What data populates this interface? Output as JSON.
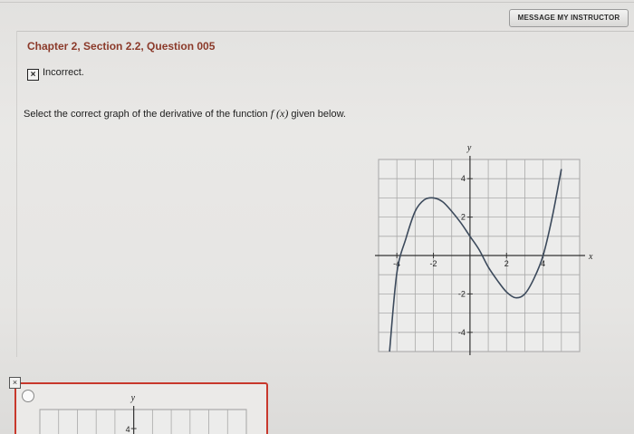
{
  "header": {
    "message_button": "MESSAGE MY INSTRUCTOR"
  },
  "question": {
    "title": "Chapter 2, Section 2.2, Question 005",
    "status": "Incorrect.",
    "status_icon": "x-mark-icon",
    "prompt_text": "Select the correct graph of the derivative of the function ",
    "prompt_math": "f (x)",
    "prompt_suffix": " given below."
  },
  "main_graph": {
    "x_axis_label": "x",
    "y_axis_label": "y",
    "x_tick_labels": [
      "-4",
      "-2",
      "2",
      "4"
    ],
    "y_tick_labels": [
      "4",
      "2",
      "-2",
      "-4"
    ],
    "curve_color": "#3c4a5c"
  },
  "answer_option": {
    "y_axis_label": "y",
    "y_tick_label": "4",
    "marker_label": "×",
    "border_color": "#c8382c"
  },
  "chart_data": {
    "type": "line",
    "title": "",
    "xlabel": "x",
    "ylabel": "y",
    "xlim": [
      -5,
      6
    ],
    "ylim": [
      -5,
      5
    ],
    "grid": true,
    "series": [
      {
        "x": [
          -4.4,
          -4,
          -3.5,
          -3,
          -2.5,
          -2,
          -1.5,
          -1,
          -0.5,
          0,
          0.5,
          1,
          1.5,
          2,
          2.5,
          3,
          3.5,
          4,
          4.5,
          5
        ],
        "y": [
          -5.0,
          -0.9,
          0.9,
          2.3,
          2.9,
          3.0,
          2.8,
          2.3,
          1.7,
          1.0,
          0.3,
          -0.6,
          -1.3,
          -1.9,
          -2.2,
          -2.0,
          -1.2,
          0.0,
          2.0,
          4.5
        ]
      }
    ]
  }
}
